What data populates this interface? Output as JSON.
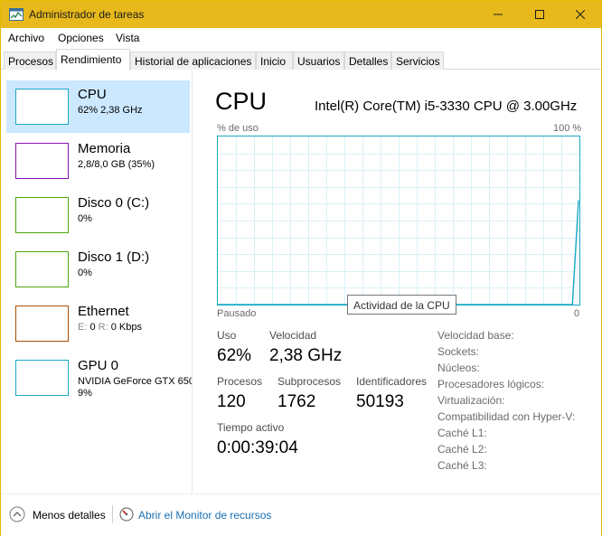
{
  "window": {
    "title": "Administrador de tareas",
    "icon": "task-manager-icon",
    "accent": "#e8b91c",
    "graph_border": "#17a9c4",
    "selected_bg": "#cce8ff"
  },
  "menu": [
    "Archivo",
    "Opciones",
    "Vista"
  ],
  "tabs": [
    "Procesos",
    "Rendimiento",
    "Historial de aplicaciones",
    "Inicio",
    "Usuarios",
    "Detalles",
    "Servicios"
  ],
  "active_tab": "Rendimiento",
  "sidebar": {
    "items": [
      {
        "name": "CPU",
        "sub": "62% 2,38 GHz",
        "color": "#17a9c4"
      },
      {
        "name": "Memoria",
        "sub": "2,8/8,0 GB (35%)",
        "color": "#8b12ae"
      },
      {
        "name": "Disco 0 (C:)",
        "sub": "0%",
        "color": "#4da60c"
      },
      {
        "name": "Disco 1 (D:)",
        "sub": "0%",
        "color": "#4da60c"
      },
      {
        "name": "Ethernet",
        "sub_parts": {
          "send_label": "E:",
          "send": "0",
          "recv_label": "R:",
          "recv": "0 Kbps"
        },
        "color": "#a74f01"
      },
      {
        "name": "GPU 0",
        "sub": "NVIDIA GeForce GTX 650",
        "sub2": "9%",
        "color": "#17a9c4"
      }
    ]
  },
  "detail": {
    "title": "CPU",
    "model": "Intel(R) Core(TM) i5-3330 CPU @ 3.00GHz",
    "graph_label_left": "% de uso",
    "graph_label_right": "100 %",
    "graph_bottom_left": "Pausado",
    "graph_bottom_right": "0",
    "tooltip": "Actividad de la CPU",
    "usage_series": [
      0,
      0,
      0,
      0,
      0,
      0,
      0,
      0,
      0,
      0,
      0,
      0,
      0,
      0,
      0,
      0,
      0,
      0,
      0,
      0,
      0,
      0,
      0,
      0,
      0,
      0,
      0,
      0,
      0,
      0,
      0,
      0,
      0,
      0,
      0,
      0,
      0,
      0,
      0,
      0,
      0,
      0,
      0,
      0,
      0,
      0,
      0,
      0,
      0,
      0,
      0,
      0,
      0,
      0,
      0,
      0,
      0,
      0,
      0,
      62
    ],
    "stats": {
      "uso_label": "Uso",
      "uso": "62%",
      "velocidad_label": "Velocidad",
      "velocidad": "2,38 GHz",
      "procesos_label": "Procesos",
      "procesos": "120",
      "subprocesos_label": "Subprocesos",
      "subprocesos": "1762",
      "identificadores_label": "Identificadores",
      "identificadores": "50193",
      "tiempo_label": "Tiempo activo",
      "tiempo": "0:00:39:04"
    },
    "specs": [
      "Velocidad base:",
      "Sockets:",
      "Núcleos:",
      "Procesadores lógicos:",
      "Virtualización:",
      "Compatibilidad con Hyper-V:",
      "Caché L1:",
      "Caché L2:",
      "Caché L3:"
    ]
  },
  "footer": {
    "fewer_details": "Menos detalles",
    "resource_monitor": "Abrir el Monitor de recursos"
  }
}
